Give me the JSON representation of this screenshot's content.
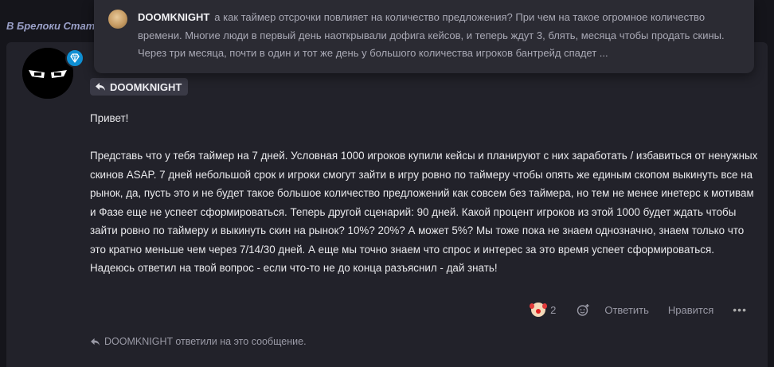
{
  "breadcrumb": {
    "text": "В Брелоки Стат"
  },
  "tooltip": {
    "author": "DOOMKNIGHT",
    "text": "а как таймер отсрочки повлияет на количество предложения? При чем на такое огромное количество времени. Многие люди в первый день наоткрывали дофига кейсов, и теперь ждут 3, блять, месяца чтобы продать скины. Через три месяца, почти в один и тот же день у большого количества игроков бантрейд спадет ..."
  },
  "post": {
    "reply_to": "DOOMKNIGHT",
    "greeting": "Привет!",
    "body": "Представь что у тебя таймер на 7 дней. Условная 1000 игроков купили кейсы и планируют с них заработать / избавиться от ненужных скинов ASAP. 7 дней небольшой срок и игроки смогут зайти в игру ровно по таймеру чтобы опять же единым скопом выкинуть все на рынок, да, пусть это и не будет такое большое количество предложений как совсем без таймера, но тем не менее инетерс к мотивам и Фазе еще не успеет сформироваться. Теперь другой сценарий: 90 дней. Какой процент игроков из этой 1000 будет ждать чтобы зайти ровно по таймеру и выкинуть скин на рынок? 10%? 20%? А может 5%? Мы тоже пока не знаем однозначно, знаем только что это кратно меньше чем через 7/14/30 дней. А еще мы точно знаем что спрос и интерес за это время успеет сформироваться.",
    "closing": "Надеюсь ответил на твой вопрос - если что-то не до конца разъяснил - дай знать!"
  },
  "actions": {
    "reaction_count": "2",
    "reply_label": "Ответить",
    "like_label": "Нравится",
    "more_label": "•••"
  },
  "replied_note": "DOOMKNIGHT ответили на это сообщение.",
  "colors": {
    "page_bg": "#15151b",
    "post_bg": "#22222a",
    "tooltip_bg": "#2b2b33",
    "badge": "#0f8fd3",
    "chip_bg": "#3a3a46"
  }
}
